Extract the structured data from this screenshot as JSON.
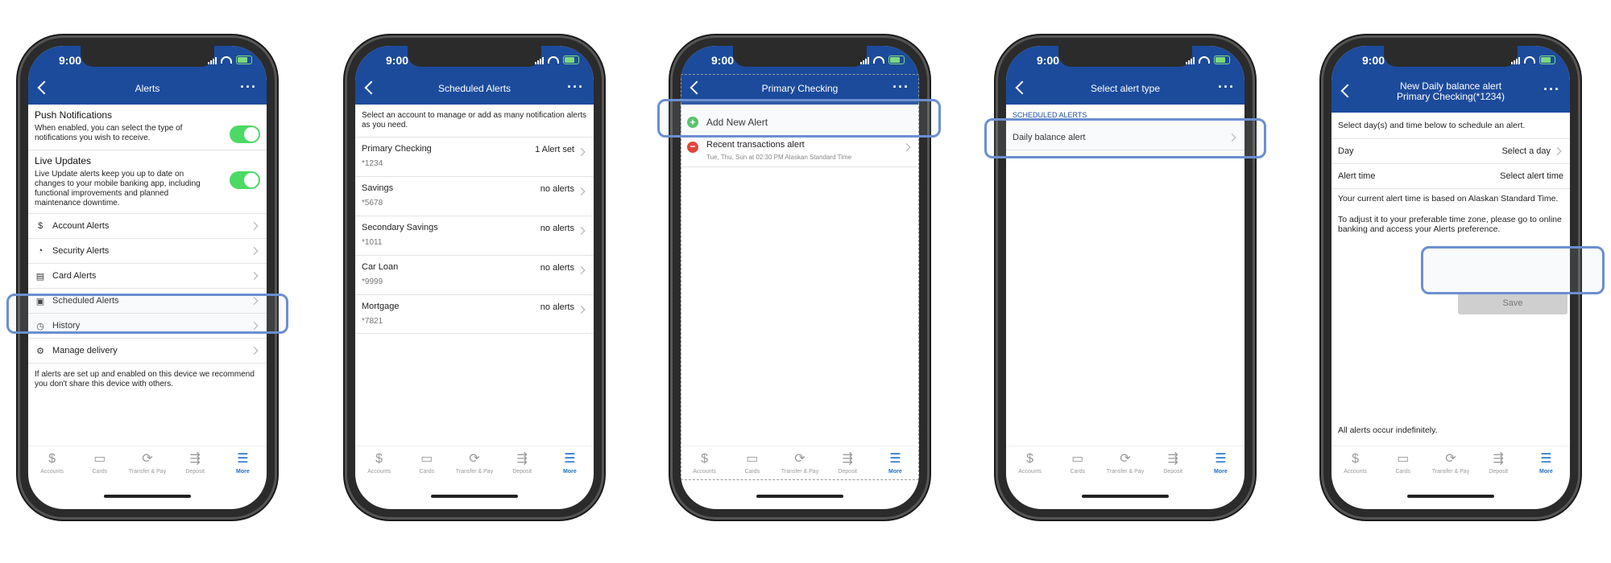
{
  "status": {
    "time": "9:00"
  },
  "tabbar": [
    {
      "label": "Accounts",
      "icon": "dollar-icon",
      "glyph": "$"
    },
    {
      "label": "Cards",
      "icon": "card-icon",
      "glyph": "▭"
    },
    {
      "label": "Transfer & Pay",
      "icon": "transfer-icon",
      "glyph": "⟳"
    },
    {
      "label": "Deposit",
      "icon": "deposit-icon",
      "glyph": "⇶"
    },
    {
      "label": "More",
      "icon": "menu-icon",
      "glyph": "☰"
    }
  ],
  "screen1": {
    "title": "Alerts",
    "push_title": "Push Notifications",
    "push_desc": "When enabled, you can select the type of notifications you wish to receive.",
    "live_title": "Live Updates",
    "live_desc": "Live Update alerts keep you up to date on changes to your mobile banking app, including functional improvements and planned maintenance downtime.",
    "items": [
      {
        "label": "Account Alerts",
        "icon": "dollar-icon",
        "glyph": "$"
      },
      {
        "label": "Security Alerts",
        "icon": "shield-icon",
        "glyph": "◔"
      },
      {
        "label": "Card Alerts",
        "icon": "card-icon",
        "glyph": "▤"
      },
      {
        "label": "Scheduled Alerts",
        "icon": "calendar-icon",
        "glyph": "▣"
      },
      {
        "label": "History",
        "icon": "history-icon",
        "glyph": "◷"
      },
      {
        "label": "Manage delivery",
        "icon": "gear-icon",
        "glyph": "⚙"
      }
    ],
    "note": "If alerts are set up and enabled on this device we recommend you don't share this device with others."
  },
  "screen2": {
    "title": "Scheduled Alerts",
    "desc": "Select an account to manage or add as many notification alerts as you need.",
    "accounts": [
      {
        "name": "Primary Checking",
        "number": "*1234",
        "status": "1 Alert set"
      },
      {
        "name": "Savings",
        "number": "*5678",
        "status": "no alerts"
      },
      {
        "name": "Secondary Savings",
        "number": "*1011",
        "status": "no alerts"
      },
      {
        "name": "Car Loan",
        "number": "*9999",
        "status": "no alerts"
      },
      {
        "name": "Mortgage",
        "number": "*7821",
        "status": "no alerts"
      }
    ]
  },
  "screen3": {
    "title": "Primary Checking",
    "add_label": "Add New Alert",
    "alert_title": "Recent transactions alert",
    "alert_schedule": "Tue, Thu, Sun at 02:30 PM Alaskan Standard Time"
  },
  "screen4": {
    "title": "Select alert type",
    "section": "SCHEDULED ALERTS",
    "option": "Daily balance alert"
  },
  "screen5": {
    "title_line1": "New Daily balance alert",
    "title_line2": "Primary Checking(*1234)",
    "instructions": "Select day(s) and time below to schedule an alert.",
    "day_label": "Day",
    "day_value": "Select a day",
    "time_label": "Alert time",
    "time_value": "Select alert time",
    "tz_note": "Your current alert time is based on Alaskan Standard Time.",
    "adjust_note": "To adjust it to your preferable time zone, please go to online banking and access your Alerts preference.",
    "save_label": "Save",
    "footer": "All alerts occur indefinitely."
  }
}
